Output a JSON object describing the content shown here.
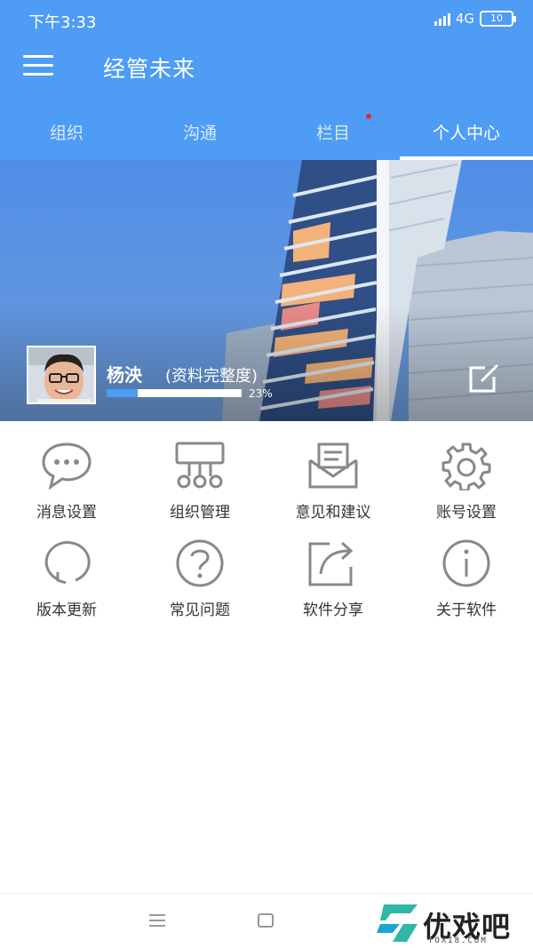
{
  "status_bar": {
    "time": "下午3:33",
    "network": "4G",
    "battery": "10"
  },
  "header": {
    "title": "经管未来"
  },
  "tabs": [
    {
      "label": "组织"
    },
    {
      "label": "沟通"
    },
    {
      "label": "栏目",
      "has_dot": true
    },
    {
      "label": "个人中心",
      "active": true
    }
  ],
  "profile": {
    "name": "杨泱",
    "subtitle": "(资料完整度)",
    "completeness_percent": 23,
    "completeness_text": "23%"
  },
  "grid": [
    {
      "label": "消息设置",
      "icon": "chat-bubble-icon"
    },
    {
      "label": "组织管理",
      "icon": "org-chart-icon"
    },
    {
      "label": "意见和建议",
      "icon": "mail-icon"
    },
    {
      "label": "账号设置",
      "icon": "gear-icon"
    },
    {
      "label": "版本更新",
      "icon": "refresh-icon"
    },
    {
      "label": "常见问题",
      "icon": "question-icon"
    },
    {
      "label": "软件分享",
      "icon": "share-icon"
    },
    {
      "label": "关于软件",
      "icon": "info-icon"
    }
  ],
  "watermark": {
    "text": "优戏吧",
    "sub": "YOXI8.COM"
  },
  "colors": {
    "primary": "#4e9cf3",
    "icon_gray": "#888888",
    "badge_red": "#e8262b"
  }
}
